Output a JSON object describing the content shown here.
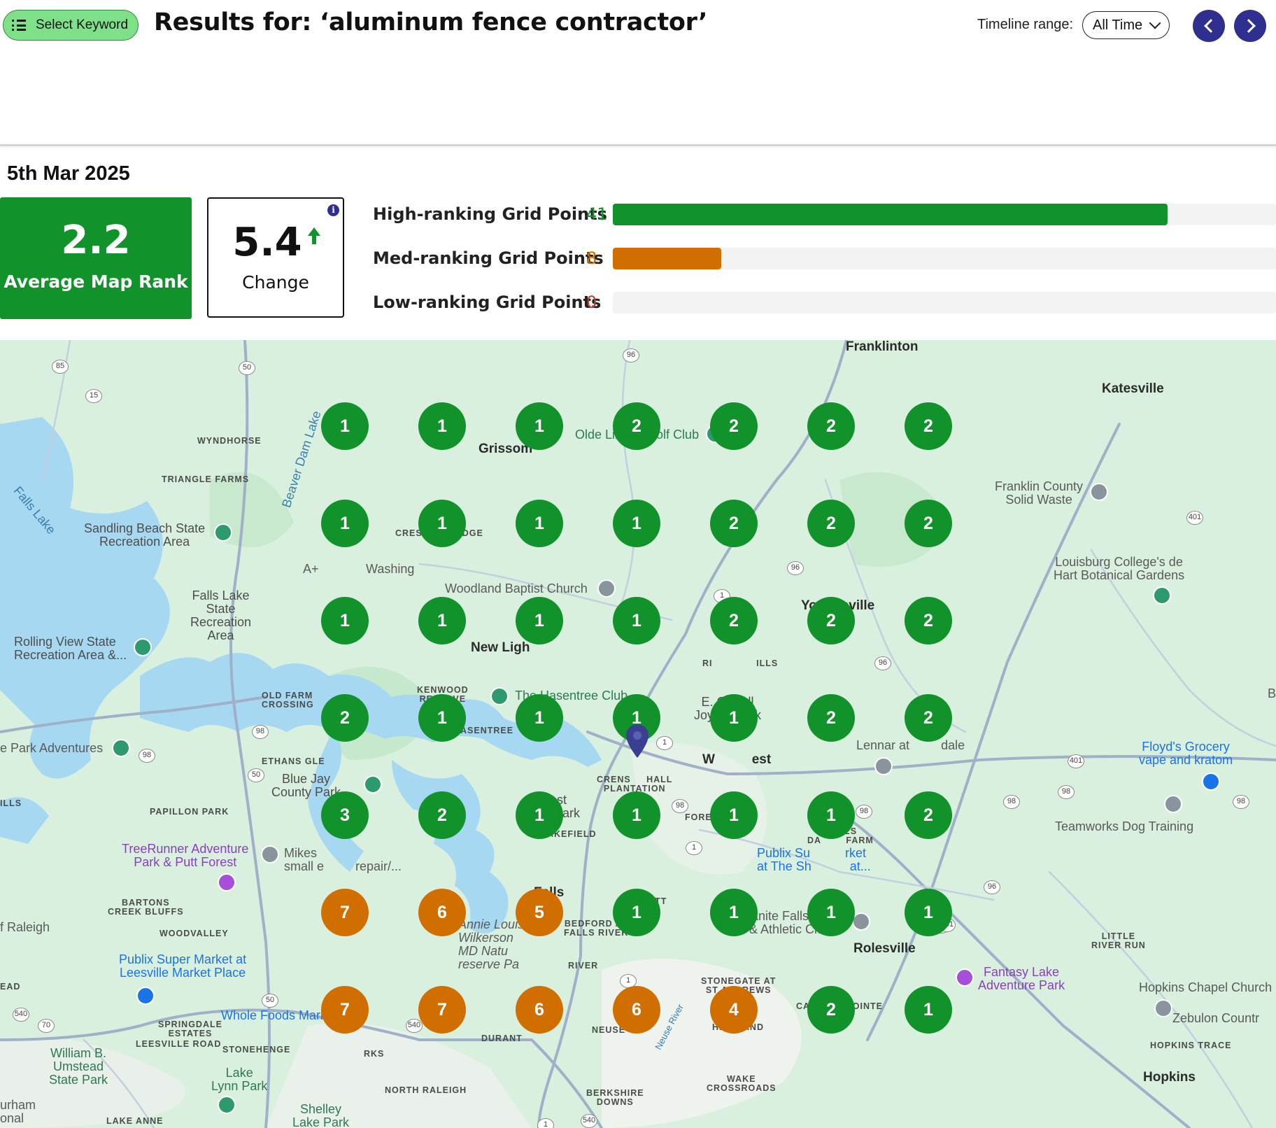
{
  "header": {
    "keyword_button": "Select Keyword",
    "title": "Results for: ‘aluminum fence contractor’",
    "timeline_label": "Timeline range:",
    "timeline_value": "All Time"
  },
  "summary": {
    "date": "5th Mar 2025",
    "average_rank": "2.2",
    "average_rank_label": "Average Map Rank",
    "change": "5.4",
    "change_label": "Change",
    "info_glyph": "i"
  },
  "ranking_bars": [
    {
      "label": "High-ranking Grid Points",
      "count": "41",
      "value": 41,
      "fraction": 0.837,
      "color": "#12922a"
    },
    {
      "label": "Med-ranking Grid Points",
      "count": "8",
      "value": 8,
      "fraction": 0.163,
      "color": "#d06f00"
    },
    {
      "label": "Low-ranking Grid Points",
      "count": "0",
      "value": 0,
      "fraction": 0,
      "color": "#c0392b"
    }
  ],
  "colors": {
    "high": "#12922a",
    "med": "#d06f00",
    "low": "#c0392b",
    "nav": "#2f2f8f",
    "water": "#a6d8f2",
    "land": "#d9f0de"
  },
  "grid_ranks": [
    [
      1,
      1,
      1,
      2,
      2,
      2,
      2
    ],
    [
      1,
      1,
      1,
      1,
      2,
      2,
      2
    ],
    [
      1,
      1,
      1,
      1,
      2,
      2,
      2
    ],
    [
      2,
      1,
      1,
      1,
      1,
      2,
      2
    ],
    [
      3,
      2,
      1,
      1,
      1,
      1,
      2
    ],
    [
      7,
      6,
      5,
      1,
      1,
      1,
      1
    ],
    [
      7,
      7,
      6,
      6,
      4,
      2,
      1
    ]
  ],
  "map_labels": {
    "franklinton": "Franklinton",
    "katesville": "Katesville",
    "grissom": "Grissom",
    "olde_liberty": "Olde Liberty Golf Club",
    "wyndhorse": "WYNDHORSE",
    "triangle_farms": "TRIANGLE FARMS",
    "falls_lake": "Falls Lake",
    "beaver_dam_lake": "Beaver Dam Lake",
    "sandling_beach": "Sandling Beach State\nRecreation Area",
    "crescent_ridge": "CRESCENT RIDGE",
    "a_plus": "A+",
    "washing": "Washing",
    "woodland_baptist": "Woodland Baptist Church",
    "falls_lake_sra": "Falls Lake\nState\nRecreation\nArea",
    "rolling_view": "Rolling View State\nRecreation Area &...",
    "new_light": "New Ligh",
    "kenwood_reserve": "KENWOOD\nRESERVE",
    "hasentree_club": "The Hasentree Club",
    "old_farm": "OLD FARM\nCROSSING",
    "hasentree": "HASENTREE",
    "park_adventures": "e Park Adventures",
    "ethans_glen": "ETHANS GLE",
    "blue_jay": "Blue Jay\nCounty Park",
    "forest_ridge": "Forest\nRidge Park",
    "crenshaw": "CRENS     HALL\nPLANTATION",
    "e_carroll": "E. Carroll\nJoyner Park",
    "wake_forest": "W          est",
    "lennar": "Lennar at         dale",
    "youngsville": "Youngsville",
    "ri_hills": "RI              ILLS",
    "franklin_county": "Franklin County\nSolid Waste",
    "louisburg": "Louisburg College's de\nHart Botanical Gardens",
    "floyds": "Floyd's Grocery\nvape and kratom",
    "teamworks": "Teamworks Dog Training",
    "papillon_park": "PAPILLON PARK",
    "illis": "ILLS",
    "treerunner": "TreeRunner Adventure\nPark & Putt Forest",
    "mikes": "Mikes\nsmall e         repair/...",
    "forestville": "FORESTVILLE",
    "jones_dairy": "JONES\nDA        FARM",
    "publix_sh": "Publix Su          rket\nat The Sh           at...",
    "wakefield": "AKEFIELD",
    "falls": "Falls",
    "wyatt": "WYATT",
    "bartons": "BARTONS\nCREEK BLUFFS",
    "of_raleigh": "f Raleigh",
    "woodvalley": "WOODVALLEY",
    "annie_louise": "Annie Louise\nWilkerson\nMD Natu\nreserve Pa",
    "bedford": "BEDFORD AT\nFALLS RIVER",
    "river": "RIVER",
    "granite_falls": "Granite Falls Swim\n& Athletic Club",
    "rolesville": "Rolesville",
    "little_river": "LITTLE\nRIVER RUN",
    "publix_leesville": "Publix Super Market at\nLeesville Market Place",
    "stonegate": "STONEGATE AT\nST ANDREWS",
    "fantasy_lake": "Fantasy Lake\nAdventure Park",
    "hopkins_chapel": "Hopkins Chapel Church",
    "ead": "EAD",
    "whole_foods": "Whole Foods Market",
    "carlton_pointe": "CARLTON POINTE",
    "zebulon": "Zebulon Countr",
    "springdale": "SPRINGDALE\nESTATES",
    "leesville_road": "LEESVILLE ROAD",
    "stonehenge": "STONEHENGE",
    "durant": "DURANT",
    "rks": "RKS",
    "neuse": "NEUSE",
    "highland": "HIGHLAND",
    "hopkins_trace": "HOPKINS TRACE",
    "william_umstead": "William B.\nUmstead\nState Park",
    "lake_lynn": "Lake\nLynn Park",
    "north_raleigh": "NORTH RALEIGH",
    "berkshire": "BERKSHIRE\nDOWNS",
    "wake_crossroads": "WAKE\nCROSSROADS",
    "hopkins": "Hopkins",
    "durham": "urham\nonal",
    "lake_anne": "LAKE ANNE",
    "shelley": "Shelley\nLake Park",
    "neuse_river": "Neuse River",
    "b_edge": "B"
  },
  "road_shields": [
    "85",
    "15",
    "50",
    "96",
    "1",
    "401",
    "96",
    "1",
    "96",
    "98",
    "98",
    "50",
    "1",
    "98",
    "98",
    "98",
    "401",
    "98",
    "98",
    "1",
    "401",
    "96",
    "540",
    "70",
    "50",
    "540",
    "1",
    "540",
    "401",
    "1"
  ]
}
